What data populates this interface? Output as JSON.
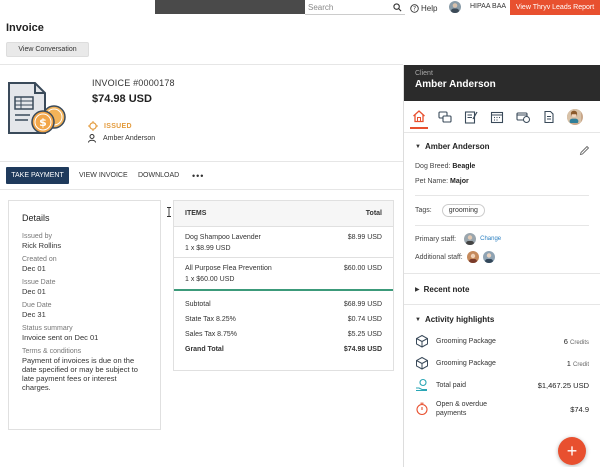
{
  "topbar": {
    "search_placeholder": "Search",
    "help_label": "Help",
    "account_label": "HIPAA BAA",
    "leads_button": "View Thryv Leads Report"
  },
  "header": {
    "title": "Invoice",
    "view_conversation": "View Conversation"
  },
  "invoice": {
    "number": "INVOICE #0000178",
    "amount": "$74.98 USD",
    "status": "ISSUED",
    "client": "Amber Anderson",
    "status_color": "#e39a3b"
  },
  "actions": {
    "take_payment": "TAKE PAYMENT",
    "view_invoice": "VIEW INVOICE",
    "download": "DOWNLOAD",
    "more": "•••"
  },
  "details": {
    "title": "Details",
    "fields": [
      {
        "label": "Issued by",
        "value": "Rick Rollins"
      },
      {
        "label": "Created on",
        "value": "Dec 01"
      },
      {
        "label": "Issue Date",
        "value": "Dec 01"
      },
      {
        "label": "Due Date",
        "value": "Dec 31"
      },
      {
        "label": "Status summary",
        "value": "Invoice sent on Dec 01"
      },
      {
        "label": "Terms & conditions",
        "value": "Payment of invoices is due on the date specified or may be subject to late payment fees or interest charges."
      }
    ]
  },
  "items": {
    "header_items": "ITEMS",
    "header_total": "Total",
    "rows": [
      {
        "name": "Dog Shampoo Lavender",
        "qty": "1 x $8.99 USD",
        "price": "$8.99 USD"
      },
      {
        "name": "All Purpose Flea Prevention",
        "qty": "1 x $60.00 USD",
        "price": "$60.00 USD"
      }
    ],
    "subtotal_label": "Subtotal",
    "subtotal": "$68.99 USD",
    "state_tax_label": "State Tax 8.25%",
    "state_tax": "$0.74 USD",
    "sales_tax_label": "Sales Tax 8.75%",
    "sales_tax": "$5.25 USD",
    "grand_total_label": "Grand Total",
    "grand_total": "$74.98 USD"
  },
  "client_panel": {
    "label": "Client",
    "name": "Amber Anderson",
    "pet_name_header": "Amber Anderson",
    "dog_breed_label": "Dog Breed:",
    "dog_breed": "Beagle",
    "pet_name_label": "Pet Name:",
    "pet_name": "Major",
    "tags_label": "Tags:",
    "tag": "grooming",
    "primary_staff_label": "Primary staff:",
    "change_label": "Change",
    "additional_staff_label": "Additional staff:",
    "recent_note": "Recent note",
    "activity_title": "Activity highlights",
    "activity": [
      {
        "name": "Grooming Package",
        "value": "6",
        "unit": "Credits"
      },
      {
        "name": "Grooming Package",
        "value": "1",
        "unit": "Credit"
      },
      {
        "name": "Total paid",
        "value": "$1,467.25 USD",
        "unit": ""
      },
      {
        "name": "Open & overdue payments",
        "value": "$74.9",
        "unit": ""
      }
    ],
    "accent": "#e8502f"
  },
  "fab": "+"
}
